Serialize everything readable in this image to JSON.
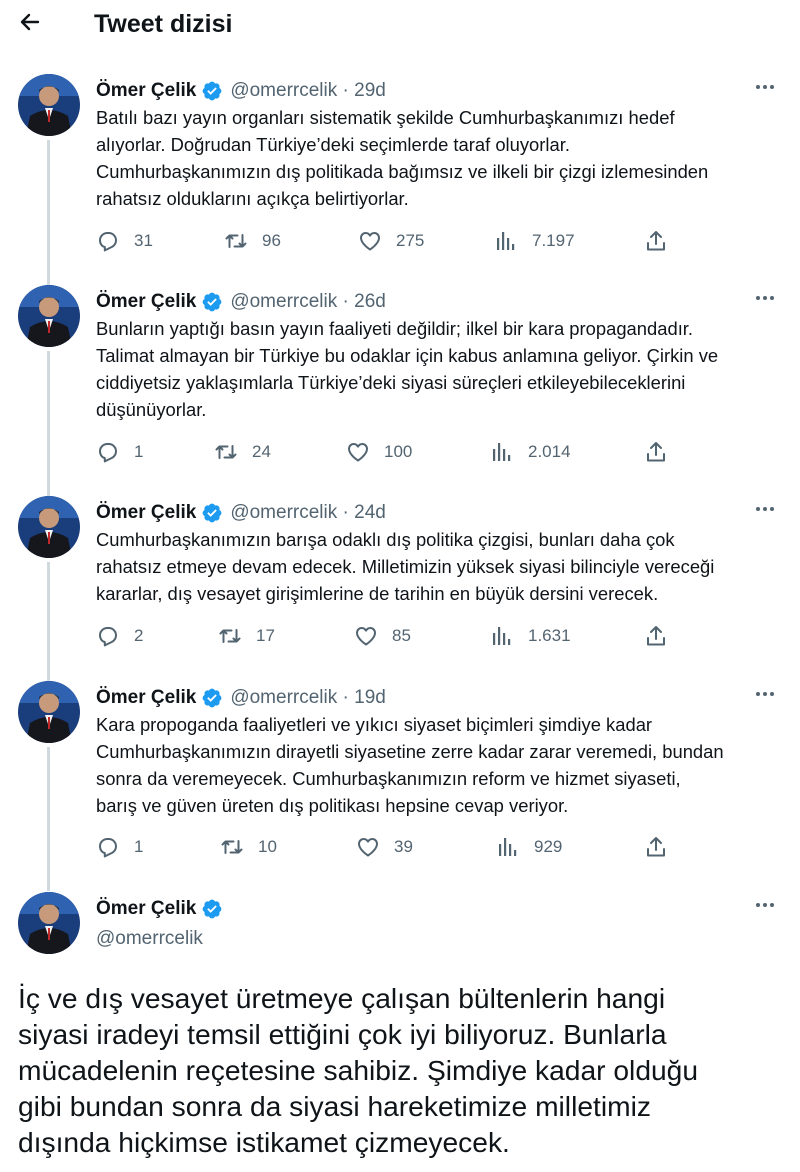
{
  "header": {
    "title": "Tweet dizisi",
    "back_icon": "arrow-left-icon"
  },
  "author": {
    "name": "Ömer Çelik",
    "handle": "@omerrcelik"
  },
  "colors": {
    "verified": "#1d9bf0",
    "text": "#0f1419",
    "muted": "#536471",
    "thread_line": "#cfd9de"
  },
  "tweets": [
    {
      "name": "Ömer Çelik",
      "meta": "@omerrcelik · 29d",
      "lines": [
        "Batılı bazı yayın organları sistematik şekilde Cumhurbaşkanımızı hedef",
        "alıyorlar. Doğrudan Türkiye’deki seçimlerde taraf oluyorlar.",
        "Cumhurbaşkanımızın dış politikada bağımsız ve ilkeli bir çizgi izlemesinden",
        "rahatsız olduklarını açıkça belirtiyorlar."
      ],
      "replies": "31",
      "retweets": "96",
      "likes": "275",
      "views": "7.197"
    },
    {
      "name": "Ömer Çelik",
      "meta": "@omerrcelik · 26d",
      "lines": [
        "Bunların yaptığı basın yayın faaliyeti değildir; ilkel bir kara propagandadır.",
        "Talimat almayan bir Türkiye bu odaklar için kabus anlamına geliyor. Çirkin ve",
        "ciddiyetsiz yaklaşımlarla Türkiye’deki siyasi süreçleri etkileyebileceklerini",
        "düşünüyorlar."
      ],
      "replies": "1",
      "retweets": "24",
      "likes": "100",
      "views": "2.014"
    },
    {
      "name": "Ömer Çelik",
      "meta": "@omerrcelik · 24d",
      "lines": [
        "Cumhurbaşkanımızın barışa odaklı dış politika çizgisi, bunları daha çok",
        "rahatsız etmeye devam edecek. Milletimizin yüksek siyasi bilinciyle vereceği",
        "kararlar, dış vesayet girişimlerine de tarihin en büyük dersini verecek."
      ],
      "replies": "2",
      "retweets": "17",
      "likes": "85",
      "views": "1.631"
    },
    {
      "name": "Ömer Çelik",
      "meta": "@omerrcelik · 19d",
      "lines": [
        "Kara propoganda faaliyetleri ve yıkıcı siyaset biçimleri şimdiye kadar",
        "Cumhurbaşkanımızın dirayetli siyasetine zerre kadar zarar veremedi, bundan",
        "sonra da veremeyecek. Cumhurbaşkanımızın reform ve hizmet siyaseti,",
        "barış ve güven üreten dış politikası hepsine cevap veriyor."
      ],
      "replies": "1",
      "retweets": "10",
      "likes": "39",
      "views": "929"
    }
  ],
  "main_tweet": {
    "name": "Ömer Çelik",
    "handle": "@omerrcelik",
    "lines": [
      "İç ve dış vesayet üretmeye çalışan bültenlerin hangi",
      "siyasi iradeyi temsil ettiğini çok iyi biliyoruz. Bunlarla",
      "mücadelenin reçetesine sahibiz. Şimdiye kadar olduğu",
      "gibi bundan sonra da siyasi hareketimize milletimiz",
      "dışında hiçkimse istikamet çizmeyecek."
    ]
  }
}
